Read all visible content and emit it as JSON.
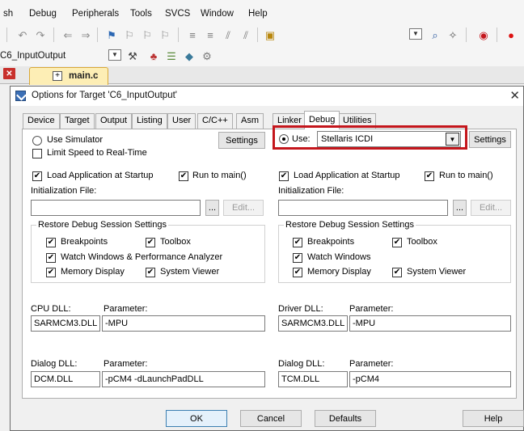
{
  "menu": {
    "items": [
      "sh",
      "Debug",
      "Peripherals",
      "Tools",
      "SVCS",
      "Window",
      "Help"
    ]
  },
  "toolbar": {
    "target_name": "C6_InputOutput"
  },
  "editor": {
    "active_tab": "main.c"
  },
  "dialog": {
    "title": "Options for Target 'C6_InputOutput'",
    "tabs": [
      "Device",
      "Target",
      "Output",
      "Listing",
      "User",
      "C/C++",
      "Asm",
      "Linker",
      "Debug",
      "Utilities"
    ],
    "active_tab": "Debug",
    "left": {
      "use_simulator": "Use Simulator",
      "limit_speed": "Limit Speed to Real-Time",
      "settings": "Settings",
      "load_app": "Load Application at Startup",
      "run_to_main": "Run to main()",
      "init_file": "Initialization File:",
      "browse": "...",
      "edit": "Edit...",
      "restore_group": "Restore Debug Session Settings",
      "breakpoints": "Breakpoints",
      "toolbox": "Toolbox",
      "watch": "Watch Windows & Performance Analyzer",
      "memory": "Memory Display",
      "system_viewer": "System Viewer",
      "dll_label": "CPU DLL:",
      "param_label": "Parameter:",
      "dll_value": "SARMCM3.DLL",
      "param_value": "-MPU",
      "dialog_dll_label": "Dialog DLL:",
      "dialog_param_label": "Parameter:",
      "dialog_dll_value": "DCM.DLL",
      "dialog_param_value": "-pCM4 -dLaunchPadDLL"
    },
    "right": {
      "use": "Use:",
      "driver": "Stellaris ICDI",
      "settings": "Settings",
      "load_app": "Load Application at Startup",
      "run_to_main": "Run to main()",
      "init_file": "Initialization File:",
      "browse": "...",
      "edit": "Edit...",
      "restore_group": "Restore Debug Session Settings",
      "breakpoints": "Breakpoints",
      "toolbox": "Toolbox",
      "watch": "Watch Windows",
      "memory": "Memory Display",
      "system_viewer": "System Viewer",
      "dll_label": "Driver DLL:",
      "param_label": "Parameter:",
      "dll_value": "SARMCM3.DLL",
      "param_value": "-MPU",
      "dialog_dll_label": "Dialog DLL:",
      "dialog_param_label": "Parameter:",
      "dialog_dll_value": "TCM.DLL",
      "dialog_param_value": "-pCM4"
    },
    "buttons": {
      "ok": "OK",
      "cancel": "Cancel",
      "defaults": "Defaults",
      "help": "Help"
    }
  },
  "colors": {
    "highlight": "#c4161c",
    "tab_active_file": "#fdeeb5"
  },
  "checkmark": "✔"
}
